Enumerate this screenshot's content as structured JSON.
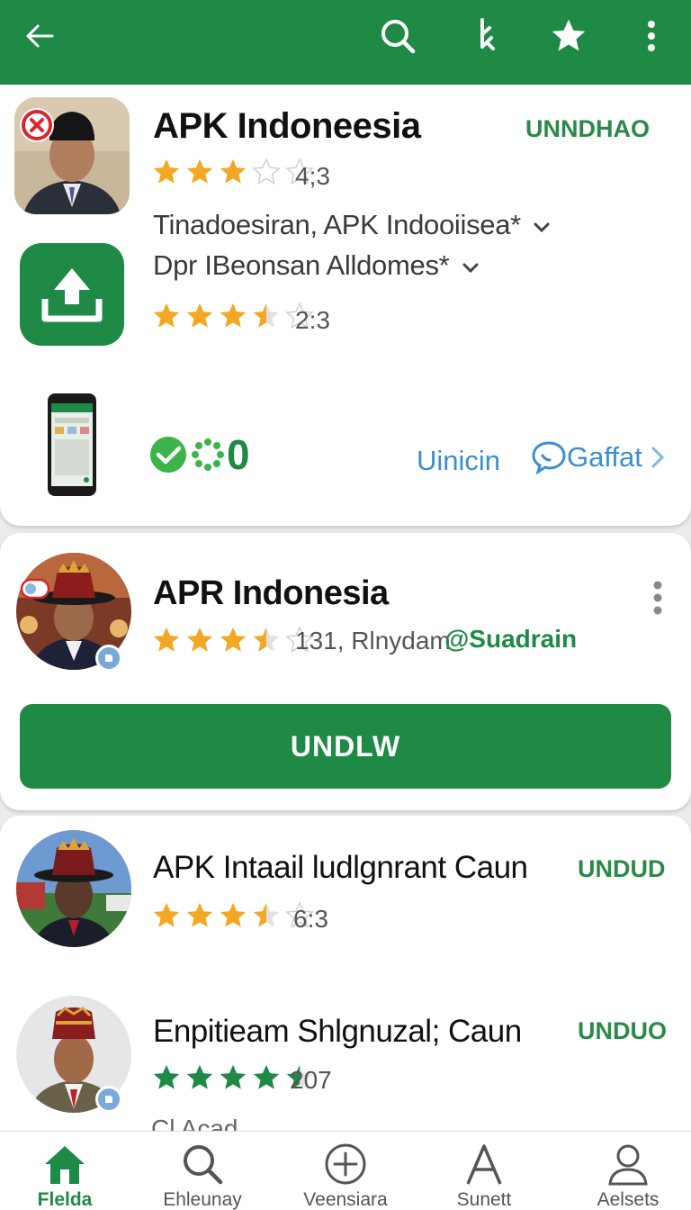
{
  "colors": {
    "brand": "#1e8a45",
    "star_gold": "#f3a723",
    "link_blue": "#3a8fd0"
  },
  "topbar": {
    "icons": [
      "back-arrow-icon",
      "search-icon",
      "share-icon",
      "star-icon",
      "more-vert-icon"
    ]
  },
  "featured": {
    "title": "APK Indoneesia",
    "action": "UNNDHAO",
    "rating": "4;3",
    "stars": 3,
    "row1_text": "Tinadoesiran, APK Indooiisea*",
    "row2_text": "Dpr IBeonsan  Alldomes*",
    "row2_rating": "2:3",
    "row2_stars": 3.5,
    "count": "0",
    "link_left": "Uinicin",
    "link_right": "Gaffat"
  },
  "card2": {
    "title": "APR Indonesia",
    "meta": "131, Rlnydam",
    "tag": "@Suadrain",
    "stars": 3.5,
    "button": "UNDLW"
  },
  "list": [
    {
      "title": "APK Intaail ludlgnrant Caun",
      "action": "UNDUD",
      "rating": "6:3",
      "stars": 3.5,
      "star_color": "gold"
    },
    {
      "title": "Enpitieam Shlgnuzal; Caun",
      "action": "UNDUO",
      "rating": "207",
      "stars": 4.5,
      "star_color": "green"
    }
  ],
  "partial_text": "Cl Acad",
  "bottom_nav": [
    {
      "label": "Flelda",
      "icon": "home-icon",
      "active": true
    },
    {
      "label": "Ehleunay",
      "icon": "search-icon",
      "active": false
    },
    {
      "label": "Veensiara",
      "icon": "add-circle-icon",
      "active": false
    },
    {
      "label": "Sunett",
      "icon": "letter-a-icon",
      "active": false
    },
    {
      "label": "Aelsets",
      "icon": "person-icon",
      "active": false
    }
  ]
}
